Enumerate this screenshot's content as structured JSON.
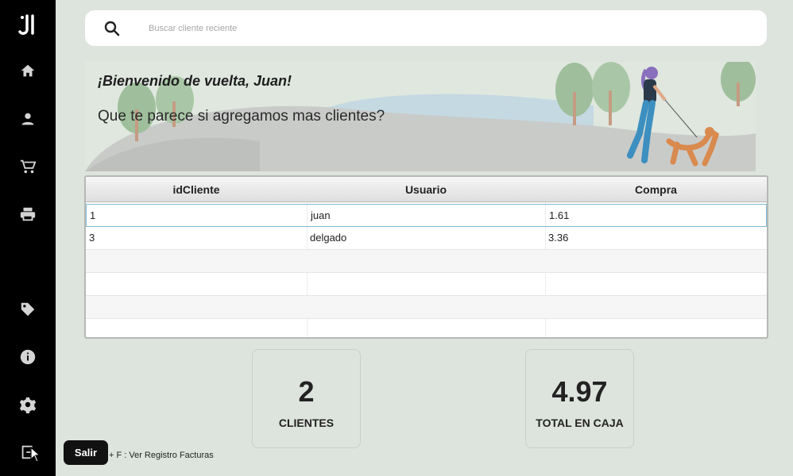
{
  "sidebar": {
    "logo": "J",
    "items": [
      {
        "icon": "home-icon"
      },
      {
        "icon": "user-icon"
      },
      {
        "icon": "cart-icon"
      },
      {
        "icon": "printer-icon"
      },
      {
        "icon": "tag-icon"
      },
      {
        "icon": "info-icon"
      },
      {
        "icon": "gear-icon"
      },
      {
        "icon": "exit-icon"
      }
    ],
    "tooltip": "Salir"
  },
  "search": {
    "placeholder": "Buscar cliente reciente"
  },
  "banner": {
    "welcome": "¡Bienvenido de vuelta, Juan!",
    "subtitle": "Que te parece si agregamos mas clientes?"
  },
  "table": {
    "columns": [
      "idCliente",
      "Usuario",
      "Compra"
    ],
    "rows": [
      [
        "1",
        "juan",
        "1.61"
      ],
      [
        "3",
        "delgado",
        "3.36"
      ]
    ]
  },
  "stats": {
    "clientes_value": "2",
    "clientes_label": "CLIENTES",
    "caja_value": "4.97",
    "caja_label": "TOTAL EN CAJA"
  },
  "footer": {
    "shortcut": "+ F : Ver Registro Facturas"
  }
}
